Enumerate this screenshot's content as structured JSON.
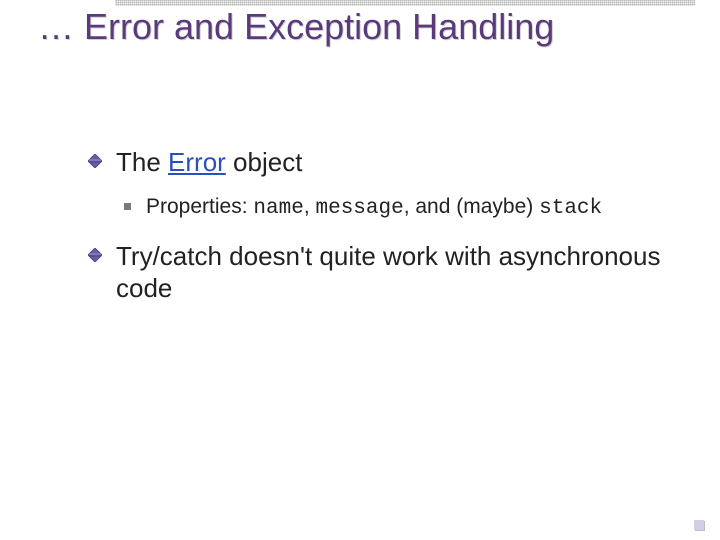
{
  "title": "… Error and Exception Handling",
  "bullets": {
    "l1a": {
      "pre": "The ",
      "link": "Error",
      "post": " object"
    },
    "l2a": {
      "pre": "Properties: ",
      "c1": "name",
      "sep1": ", ",
      "c2": "message",
      "mid": ", and (maybe) ",
      "c3": "stack"
    },
    "l1b": "Try/catch doesn't quite work with asynchronous code"
  },
  "colors": {
    "title": "#5a3a7a",
    "link": "#2a4fbf",
    "diamondFill": "#6a5aa8",
    "diamondBorder": "#4a3a7a"
  }
}
